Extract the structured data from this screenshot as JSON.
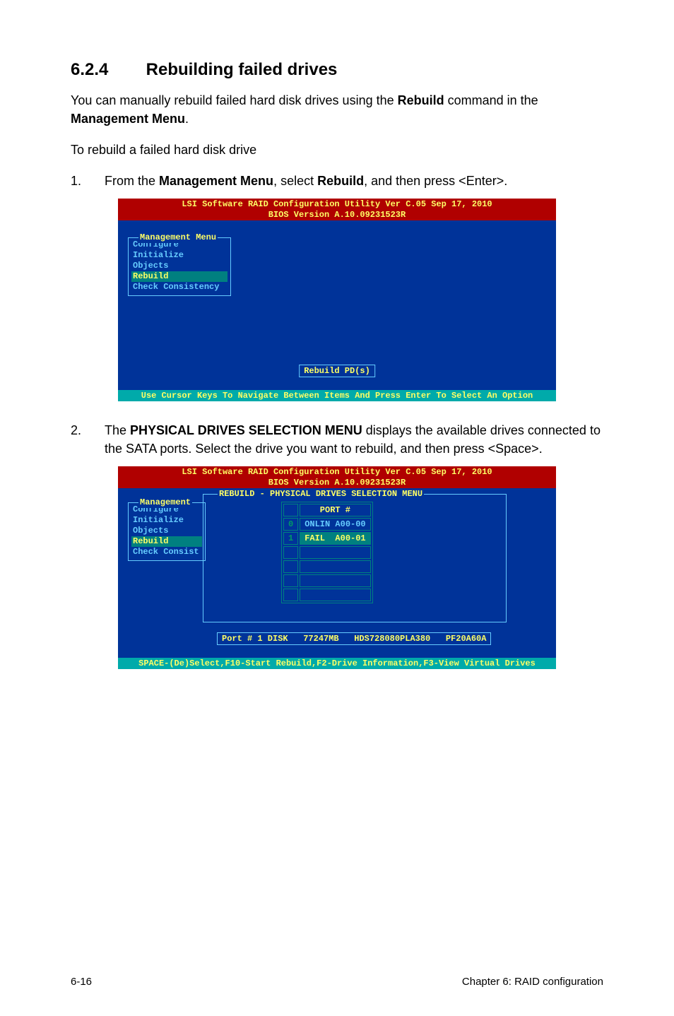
{
  "heading": {
    "number": "6.2.4",
    "title": "Rebuilding failed drives"
  },
  "intro": {
    "prefix": "You can manually rebuild failed hard disk drives using the ",
    "bold1": "Rebuild",
    "mid": " command in the ",
    "bold2": "Management Menu",
    "suffix": "."
  },
  "subintro": "To rebuild a failed hard disk drive",
  "step1": {
    "num": "1.",
    "prefix": "From the ",
    "bold1": "Management Menu",
    "mid": ", select ",
    "bold2": "Rebuild",
    "suffix": ", and then press <Enter>."
  },
  "bios1": {
    "title_line1": "LSI Software RAID Configuration Utility Ver C.05 Sep 17, 2010",
    "title_line2": "BIOS Version   A.10.09231523R",
    "menu_title": "Management Menu",
    "items": [
      "Configure",
      "Initialize",
      "Objects",
      "Rebuild",
      "Check Consistency"
    ],
    "selected_index": 3,
    "status": "Rebuild PD(s)",
    "footer": "Use Cursor Keys To Navigate Between Items And Press Enter To Select An Option"
  },
  "step2": {
    "num": "2.",
    "prefix": "The ",
    "bold1": "PHYSICAL DRIVES SELECTION MENU",
    "suffix": " displays the available drives connected to the SATA ports. Select the drive you want to rebuild, and then press <Space>."
  },
  "bios2": {
    "title_line1": "LSI Software RAID Configuration Utility Ver C.05 Sep 17, 2010",
    "title_line2": "BIOS Version   A.10.09231523R",
    "menu_title": "Management",
    "items": [
      "Configure",
      "Initialize",
      "Objects",
      "Rebuild",
      "Check Consist"
    ],
    "selected_index": 3,
    "panel_title": "REBUILD - PHYSICAL DRIVES SELECTION MENU",
    "port_header": "PORT #",
    "ports": [
      {
        "idx": "0",
        "label": "ONLIN A00-00",
        "selected": false
      },
      {
        "idx": "1",
        "label": "FAIL  A00-01",
        "selected": true
      }
    ],
    "drive_info": "Port # 1 DISK   77247MB   HDS728080PLA380   PF20A60A",
    "footer": "SPACE-(De)Select,F10-Start Rebuild,F2-Drive Information,F3-View Virtual Drives"
  },
  "footer": {
    "left": "6-16",
    "right": "Chapter 6: RAID configuration"
  }
}
